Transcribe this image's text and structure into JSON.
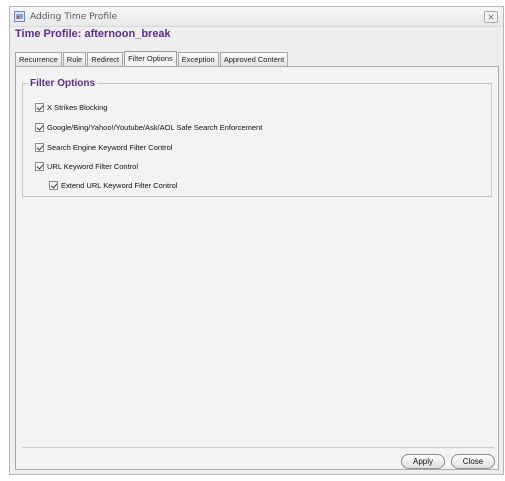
{
  "window": {
    "title": "Adding Time Profile",
    "close_glyph": "⨯",
    "icon": "app-icon"
  },
  "profile": {
    "title": "Time Profile: afternoon_break"
  },
  "tabs": [
    {
      "label": "Recurrence"
    },
    {
      "label": "Rule"
    },
    {
      "label": "Redirect"
    },
    {
      "label": "Filter Options"
    },
    {
      "label": "Exception"
    },
    {
      "label": "Approved Content"
    }
  ],
  "active_tab": "Filter Options",
  "filter_options": {
    "title": "Filter Options",
    "items": [
      {
        "label": "X Strikes Blocking",
        "checked": true
      },
      {
        "label": "Google/Bing/Yahoo!/Youtube/Ask/AOL Safe Search Enforcement",
        "checked": true
      },
      {
        "label": "Search Engine Keyword Filter Control",
        "checked": true
      },
      {
        "label": "URL Keyword Filter Control",
        "checked": true
      },
      {
        "label": "Extend URL Keyword Filter Control",
        "checked": true
      }
    ]
  },
  "buttons": {
    "apply": "Apply",
    "close": "Close"
  },
  "colors": {
    "heading": "#5a2e86",
    "panel_bg": "#f3f3f3"
  }
}
